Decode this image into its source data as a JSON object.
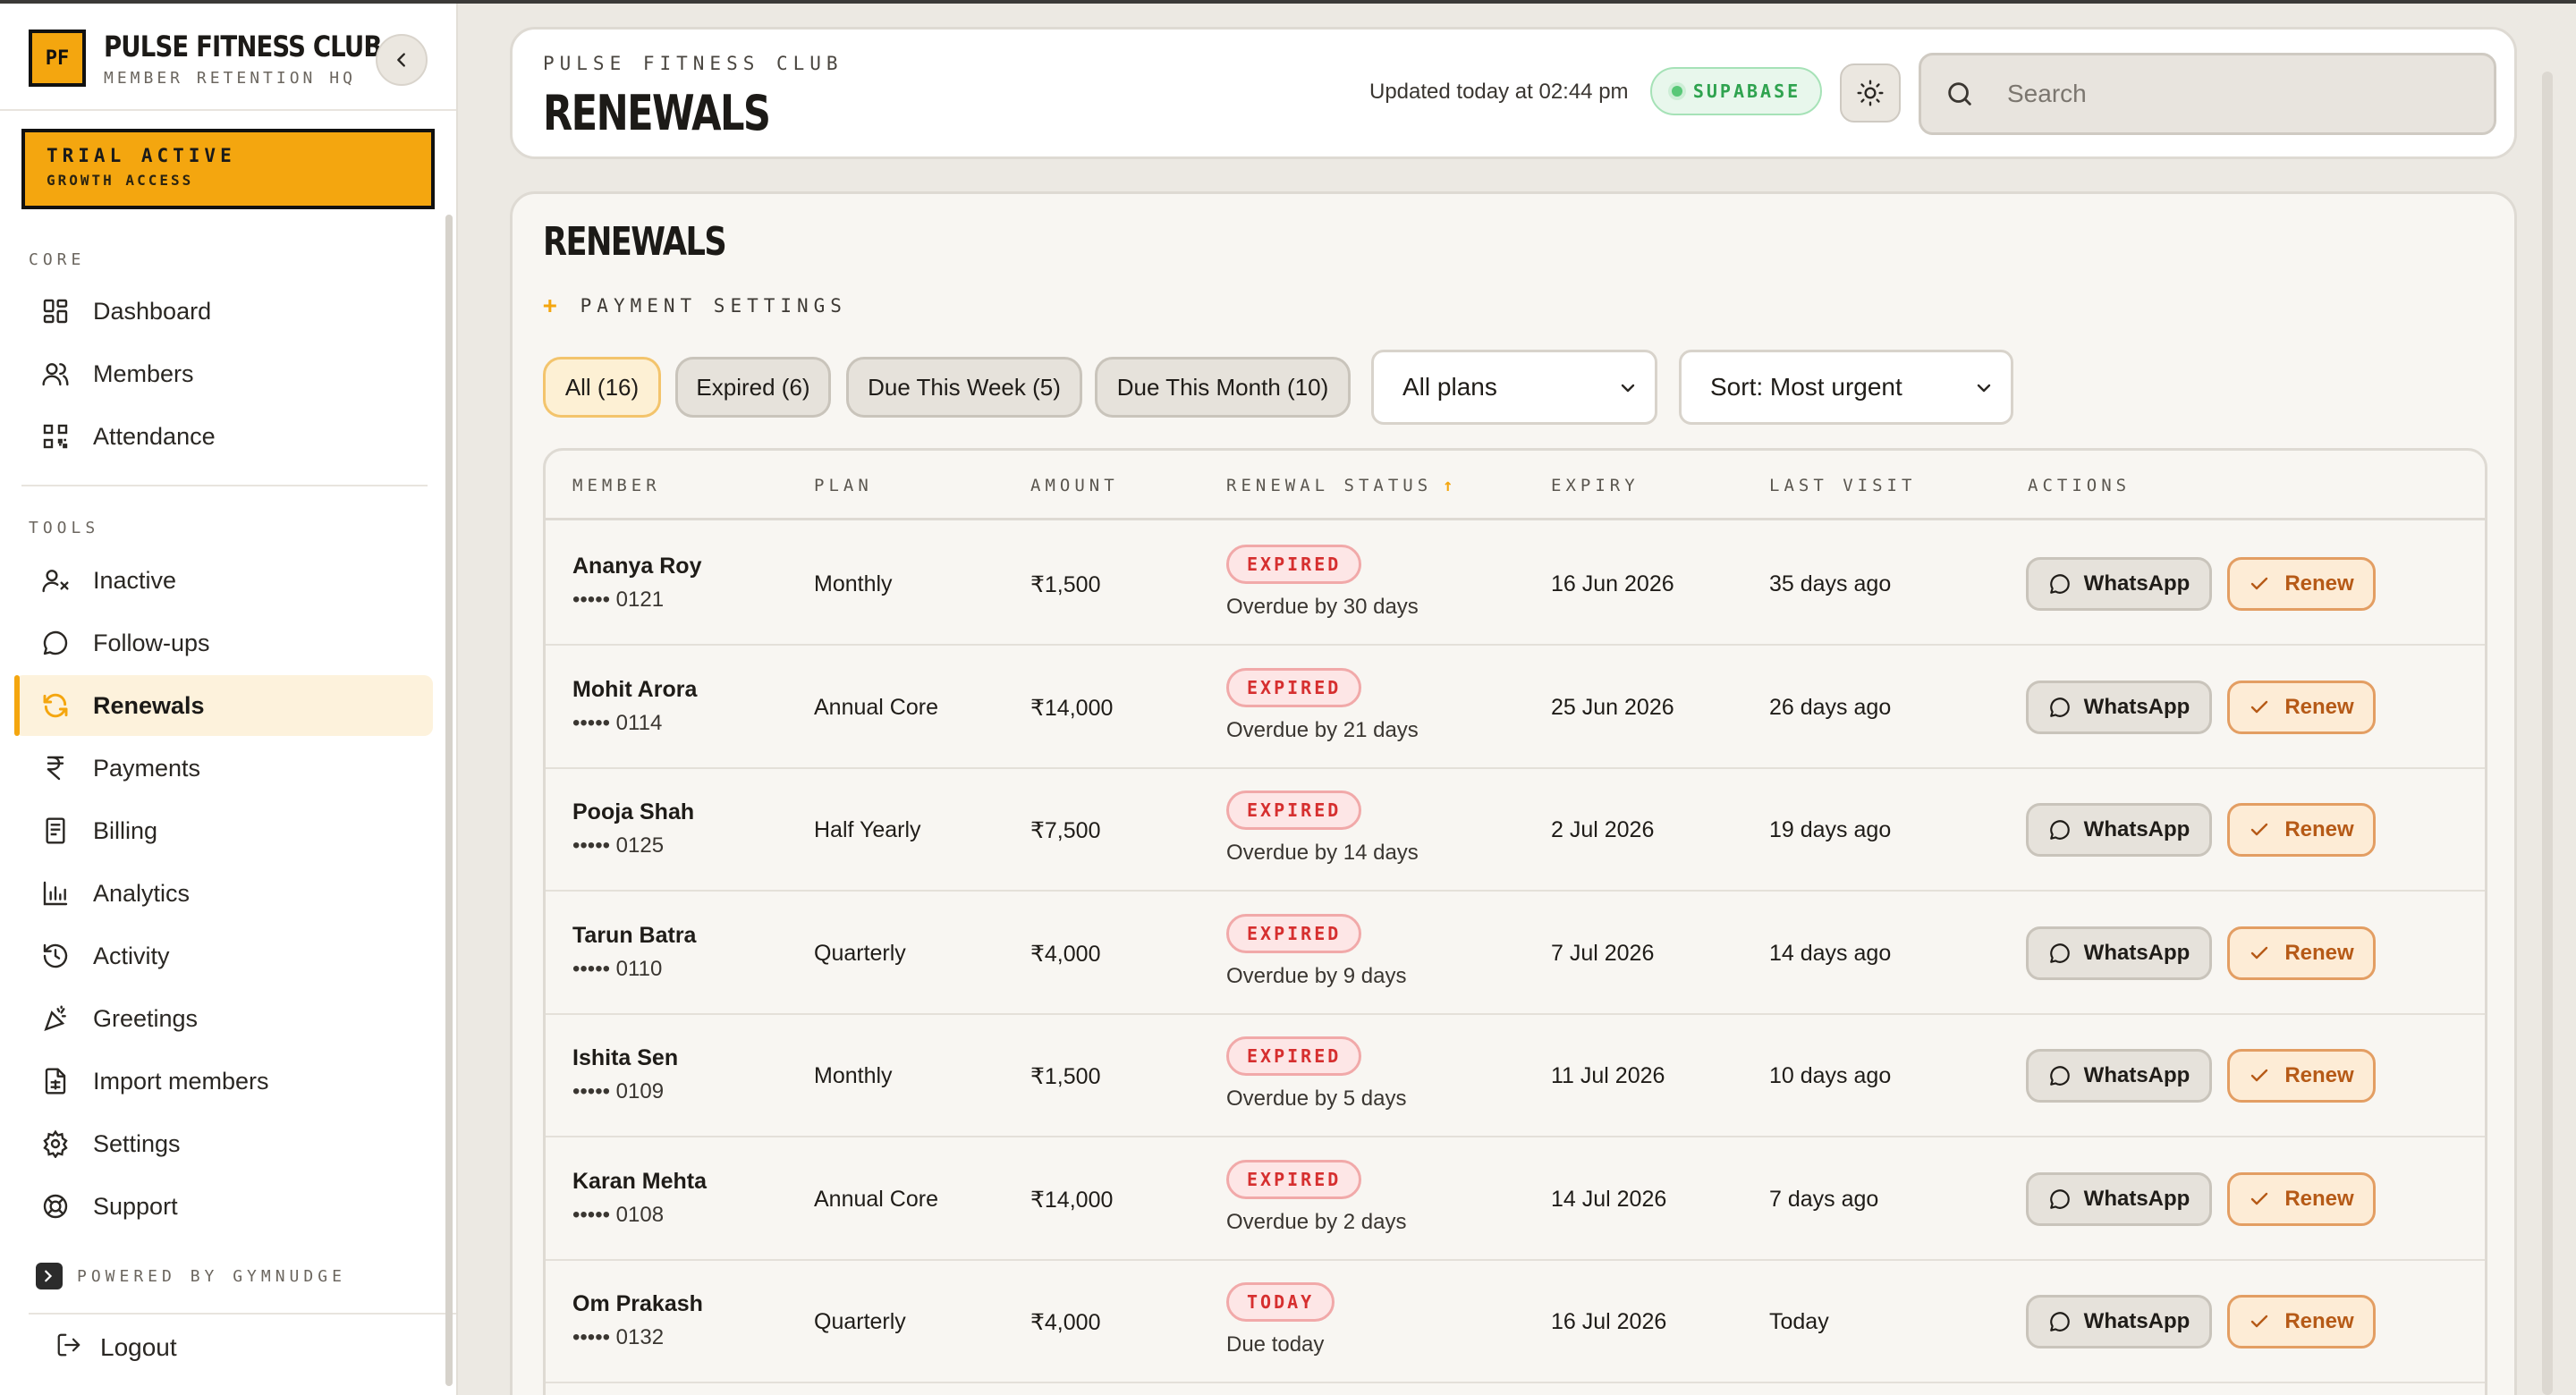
{
  "brand": {
    "logo_text": "PF",
    "title": "PULSE FITNESS CLUB",
    "subtitle": "MEMBER RETENTION HQ"
  },
  "trial": {
    "line1": "TRIAL ACTIVE",
    "line2": "GROWTH ACCESS"
  },
  "sidebar": {
    "core_label": "CORE",
    "tools_label": "TOOLS",
    "core_items": [
      {
        "label": "Dashboard",
        "icon": "dashboard-icon"
      },
      {
        "label": "Members",
        "icon": "users-icon"
      },
      {
        "label": "Attendance",
        "icon": "qr-code-icon"
      }
    ],
    "tool_items": [
      {
        "label": "Inactive",
        "icon": "user-x-icon"
      },
      {
        "label": "Follow-ups",
        "icon": "message-circle-icon"
      },
      {
        "label": "Renewals",
        "icon": "refresh-icon",
        "active": true
      },
      {
        "label": "Payments",
        "icon": "rupee-icon"
      },
      {
        "label": "Billing",
        "icon": "receipt-icon"
      },
      {
        "label": "Analytics",
        "icon": "bar-chart-icon"
      },
      {
        "label": "Activity",
        "icon": "history-icon"
      },
      {
        "label": "Greetings",
        "icon": "party-popper-icon"
      },
      {
        "label": "Import members",
        "icon": "file-spreadsheet-icon"
      },
      {
        "label": "Settings",
        "icon": "gear-icon"
      },
      {
        "label": "Support",
        "icon": "lifebuoy-icon"
      }
    ],
    "powered_by": "POWERED BY GYMNUDGE",
    "logout": "Logout"
  },
  "header": {
    "eyebrow": "PULSE FITNESS CLUB",
    "title": "RENEWALS",
    "updated": "Updated today at 02:44 pm",
    "status_badge": "SUPABASE",
    "search_placeholder": "Search"
  },
  "main": {
    "title": "RENEWALS",
    "payment_settings": "PAYMENT SETTINGS",
    "filters": [
      "All (16)",
      "Expired (6)",
      "Due This Week (5)",
      "Due This Month (10)"
    ],
    "active_filter": "All (16)",
    "plan_select": "All plans",
    "sort_select": "Sort: Most urgent"
  },
  "table": {
    "columns": [
      "MEMBER",
      "PLAN",
      "AMOUNT",
      "RENEWAL STATUS",
      "EXPIRY",
      "LAST VISIT",
      "ACTIONS"
    ],
    "sorted_column": "RENEWAL STATUS",
    "whatsapp_label": "WhatsApp",
    "renew_label": "Renew",
    "rows": [
      {
        "name": "Ananya Roy",
        "phone": "••••• 0121",
        "plan": "Monthly",
        "amount": "₹1,500",
        "status": "EXPIRED",
        "note": "Overdue by 30 days",
        "expiry": "16 Jun 2026",
        "last_visit": "35 days ago"
      },
      {
        "name": "Mohit Arora",
        "phone": "••••• 0114",
        "plan": "Annual Core",
        "amount": "₹14,000",
        "status": "EXPIRED",
        "note": "Overdue by 21 days",
        "expiry": "25 Jun 2026",
        "last_visit": "26 days ago"
      },
      {
        "name": "Pooja Shah",
        "phone": "••••• 0125",
        "plan": "Half Yearly",
        "amount": "₹7,500",
        "status": "EXPIRED",
        "note": "Overdue by 14 days",
        "expiry": "2 Jul 2026",
        "last_visit": "19 days ago"
      },
      {
        "name": "Tarun Batra",
        "phone": "••••• 0110",
        "plan": "Quarterly",
        "amount": "₹4,000",
        "status": "EXPIRED",
        "note": "Overdue by 9 days",
        "expiry": "7 Jul 2026",
        "last_visit": "14 days ago"
      },
      {
        "name": "Ishita Sen",
        "phone": "••••• 0109",
        "plan": "Monthly",
        "amount": "₹1,500",
        "status": "EXPIRED",
        "note": "Overdue by 5 days",
        "expiry": "11 Jul 2026",
        "last_visit": "10 days ago"
      },
      {
        "name": "Karan Mehta",
        "phone": "••••• 0108",
        "plan": "Annual Core",
        "amount": "₹14,000",
        "status": "EXPIRED",
        "note": "Overdue by 2 days",
        "expiry": "14 Jul 2026",
        "last_visit": "7 days ago"
      },
      {
        "name": "Om Prakash",
        "phone": "••••• 0132",
        "plan": "Quarterly",
        "amount": "₹4,000",
        "status": "TODAY",
        "note": "Due today",
        "expiry": "16 Jul 2026",
        "last_visit": "Today"
      }
    ]
  },
  "colors": {
    "accent": "#f4a60f",
    "expired_text": "#d62f2f",
    "success": "#2fa34f",
    "renew_text": "#b65a17"
  }
}
